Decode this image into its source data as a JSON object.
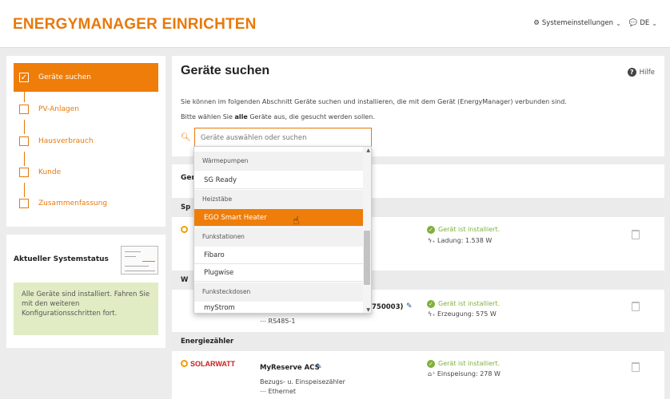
{
  "header": {
    "title": "ENERGYMANAGER EINRICHTEN",
    "settings_label": "Systemeinstellungen",
    "language_label": "DE"
  },
  "steps": [
    {
      "label": "Geräte suchen",
      "active": true,
      "checked": true
    },
    {
      "label": "PV-Anlagen",
      "active": false
    },
    {
      "label": "Hausverbrauch",
      "active": false
    },
    {
      "label": "Kunde",
      "active": false
    },
    {
      "label": "Zusammenfassung",
      "active": false
    }
  ],
  "system_status": {
    "title": "Aktueller Systemstatus",
    "message": "Alle Geräte sind installiert. Fahren Sie mit den weiteren Konfigurationsschritten fort."
  },
  "main": {
    "title": "Geräte suchen",
    "help_label": "Hilfe",
    "description_1": "Sie können im folgenden Abschnitt Geräte suchen und installieren, die mit dem Gerät (EnergyManager) verbunden sind.",
    "description_2_pre": "Bitte wählen Sie ",
    "description_2_bold": "alle",
    "description_2_post": " Geräte aus, die gesucht werden sollen.",
    "search_placeholder": "Geräte auswählen oder suchen"
  },
  "dropdown": {
    "groups": [
      {
        "label": "Wärmepumpen",
        "items": [
          "SG Ready"
        ]
      },
      {
        "label": "Heizstäbe",
        "items": [
          "EGO Smart Heater"
        ]
      },
      {
        "label": "Funkstationen",
        "items": [
          "Fibaro",
          "Plugwise"
        ]
      },
      {
        "label": "Funksteckdosen",
        "items": [
          "myStrom"
        ]
      }
    ],
    "highlighted_item": "EGO Smart Heater"
  },
  "devices": {
    "heading_partial": "Gerä",
    "section_1_partial": "Sp",
    "section_2_partial": "W",
    "section_3": "Energiezähler",
    "row1": {
      "status": "Gerät ist installiert.",
      "meter": "Ladung: 1.538 W"
    },
    "row2": {
      "name_tail": "750003)",
      "connection": "RS485-1",
      "status": "Gerät ist installiert.",
      "meter": "Erzeugung: 575 W"
    },
    "row3": {
      "brand": "SOLARWATT",
      "name": "MyReserve ACS",
      "type": "Bezugs- u. Einspeisezähler",
      "connection": "Ethernet",
      "status": "Gerät ist installiert.",
      "meter": "Einspeisung: 278 W"
    }
  },
  "colors": {
    "accent": "#ef7d0a",
    "ok_green": "#7fb03a",
    "status_bg": "#e1ecc5"
  }
}
